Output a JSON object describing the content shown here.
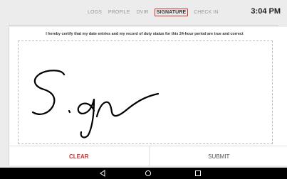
{
  "tabs": [
    {
      "label": "LOGS"
    },
    {
      "label": "PROFILE"
    },
    {
      "label": "DVIR"
    },
    {
      "label": "SIGNATURE",
      "active": true
    },
    {
      "label": "CHECK IN"
    }
  ],
  "clock": "3:04 PM",
  "certification": "I hereby certify that my date entries and my record of duty status for this 24-hour period are true and correct",
  "signature": {
    "drawn_text": "Sign"
  },
  "actions": {
    "clear_label": "CLEAR",
    "submit_label": "SUBMIT"
  },
  "colors": {
    "accent": "#d32f2f",
    "background": "#ececec",
    "nav_bar": "#000000"
  },
  "nav_icons": [
    "back-icon",
    "home-icon",
    "recents-icon"
  ]
}
